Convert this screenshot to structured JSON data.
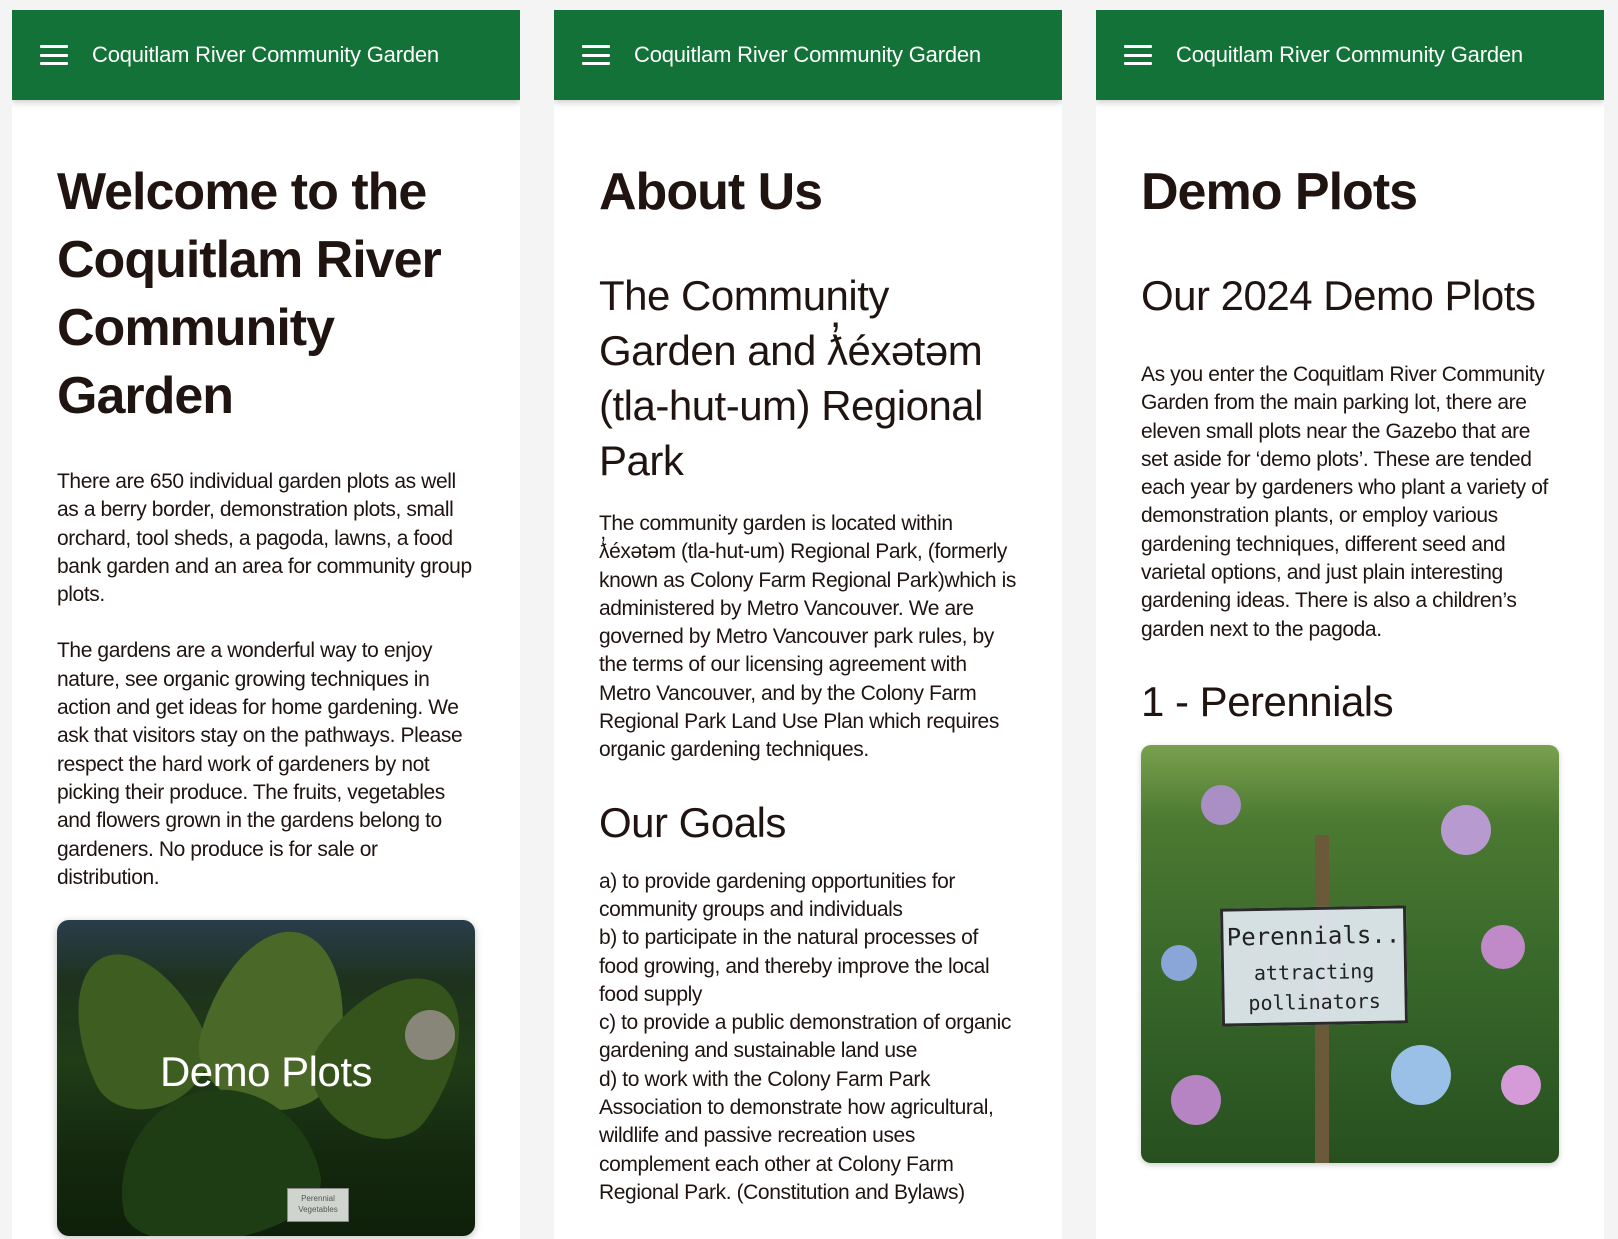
{
  "app": {
    "title": "Coquitlam River Community Garden"
  },
  "screens": [
    {
      "heading": "Welcome to the Coquitlam River Community Garden",
      "paragraphs": [
        "There are 650 individual garden plots as well as a berry border, demonstration plots, small orchard, tool sheds, a pagoda, lawns, a food bank garden and an area for community group plots.",
        "The gardens are a wonderful way to enjoy nature, see organic growing techniques in action and get ideas for home gardening. We ask that visitors stay on the pathways. Please respect the hard work of gardeners by not picking their produce. The fruits, vegetables and flowers grown in the gardens belong to gardeners. No produce is for sale or distribution."
      ],
      "card": {
        "label": "Demo Plots",
        "sign_text": "Perennial Vegetables"
      }
    },
    {
      "heading": "About Us",
      "subheading": "The Community Garden and ƛ̓éxətəm (tla-hut-um) Regional Park",
      "paragraph": "The community garden is located within ƛ̓éxətəm (tla-hut-um) Regional Park, (formerly known as Colony Farm Regional Park)which is administered by Metro Vancouver. We are governed by Metro Vancouver park rules, by the terms of our licensing agreement with Metro Vancouver, and by the Colony Farm Regional Park Land Use Plan which requires organic gardening techniques.",
      "goals_heading": "Our Goals",
      "goals": [
        "a) to provide gardening opportunities for community groups and individuals",
        "b) to participate in the natural processes of food growing, and thereby improve the local food supply",
        "c) to provide a public demonstration of organic gardening and sustainable land use",
        "d) to work with the Colony Farm Park Association to demonstrate how agricultural, wildlife and passive recreation uses complement each other at Colony Farm Regional Park. (Constitution and Bylaws)"
      ]
    },
    {
      "heading": "Demo Plots",
      "subheading": "Our 2024 Demo Plots",
      "paragraph": "As you enter the Coquitlam River Community Garden from the main parking lot, there are eleven small plots near the Gazebo that are set aside for ‘demo plots’. These are tended each year by gardeners who plant a variety of demonstration plants, or employ various gardening techniques, different seed and varietal options, and just plain interesting gardening ideas. There is also a children’s garden next to the pagoda.",
      "plot_heading": "1 - Perennials",
      "photo_sign": {
        "line1": "Perennials..",
        "line2": "attracting",
        "line3": "pollinators"
      }
    }
  ],
  "colors": {
    "appbar": "#127238",
    "text": "#1f1410",
    "background": "#f4f4f4"
  },
  "icons": {
    "menu": "hamburger-menu-icon"
  }
}
